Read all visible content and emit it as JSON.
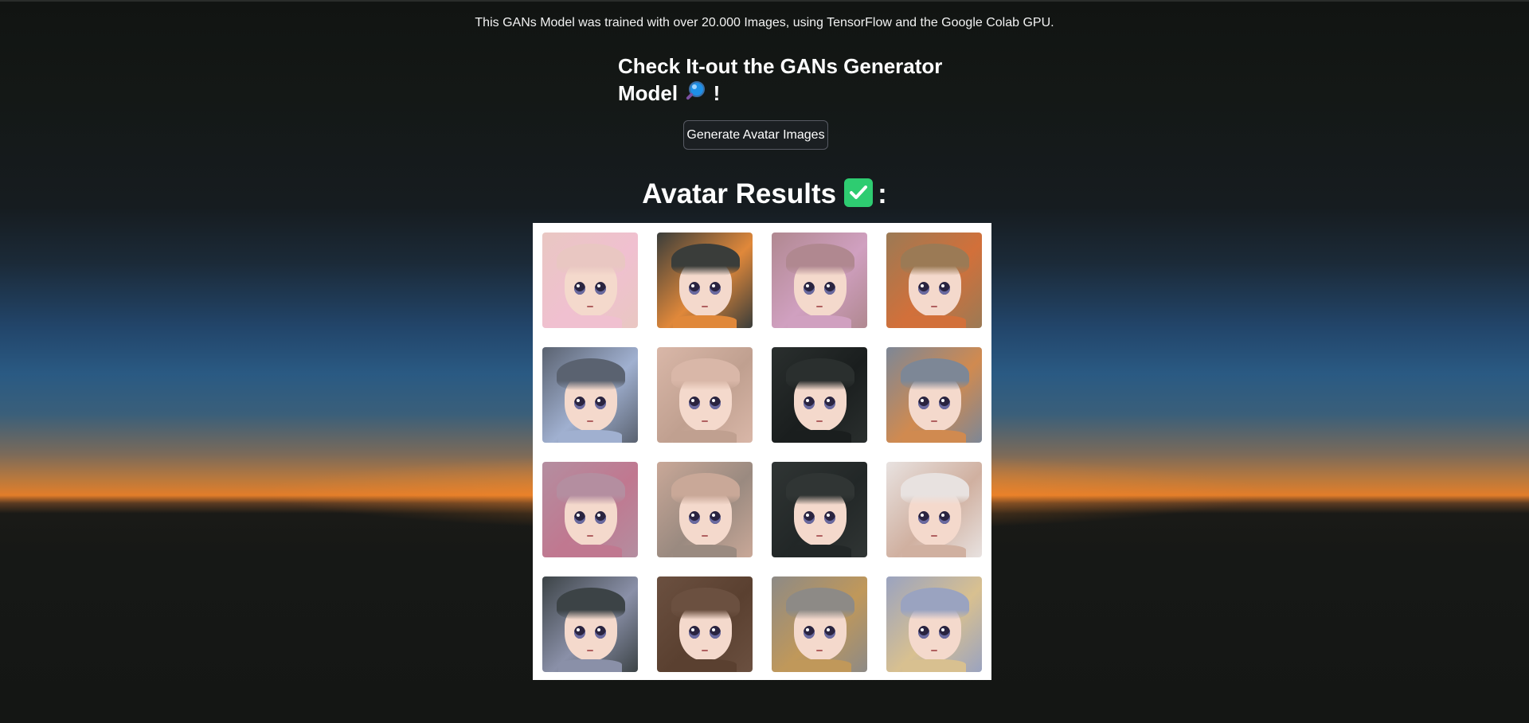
{
  "page": {
    "intro_text": "This GANs Model was trained with over 20.000 Images, using TensorFlow and the Google Colab GPU.",
    "subtitle_line1": "Check It-out the GANs Generator",
    "subtitle_line2": "Model",
    "subtitle_emoji_icon": "magnifying-glass-icon",
    "subtitle_suffix": "!",
    "generate_button_label": "Generate Avatar Images",
    "results_title": "Avatar Results",
    "results_title_icon": "check-mark-button-icon",
    "results_title_suffix": ":"
  },
  "avatars": {
    "count": 16,
    "rows": 4,
    "columns": 4,
    "hair_colors": [
      "#e9c7c2",
      "#3a3d3a",
      "#b08890",
      "#9b7a55",
      "#5a6270",
      "#d9b7a8",
      "#2a2f2e",
      "#7d8796",
      "#b48ea0",
      "#c9a898",
      "#303534",
      "#e8e2e0",
      "#3c4346",
      "#6b5040",
      "#8d8a86",
      "#9aa3c0"
    ],
    "accent_colors": [
      "#f0c0d0",
      "#e0883a",
      "#d0a0c0",
      "#d2703a",
      "#a0b0d0",
      "#c0a090",
      "#1a1e1e",
      "#d08a50",
      "#c07890",
      "#9a8a80",
      "#222727",
      "#d0b0a0",
      "#8a90a8",
      "#5a4030",
      "#c0985a",
      "#d8c090"
    ]
  },
  "colors": {
    "check_green": "#2ecc71",
    "button_bg": "#1b1f22"
  }
}
